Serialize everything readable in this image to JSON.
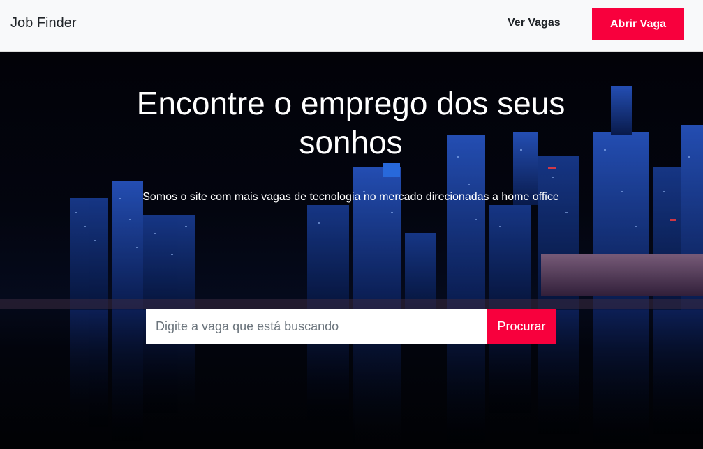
{
  "header": {
    "brand": "Job Finder",
    "nav_link": "Ver Vagas",
    "cta": "Abrir Vaga"
  },
  "hero": {
    "title": "Encontre o emprego dos seus sonhos",
    "subtitle": "Somos o site com mais vagas de tecnologia no mercado direcionadas a home office",
    "search": {
      "placeholder": "Digite a vaga que está buscando",
      "value": "",
      "button": "Procurar"
    }
  },
  "colors": {
    "accent": "#f8003d",
    "header_bg": "#f8f9fa"
  }
}
